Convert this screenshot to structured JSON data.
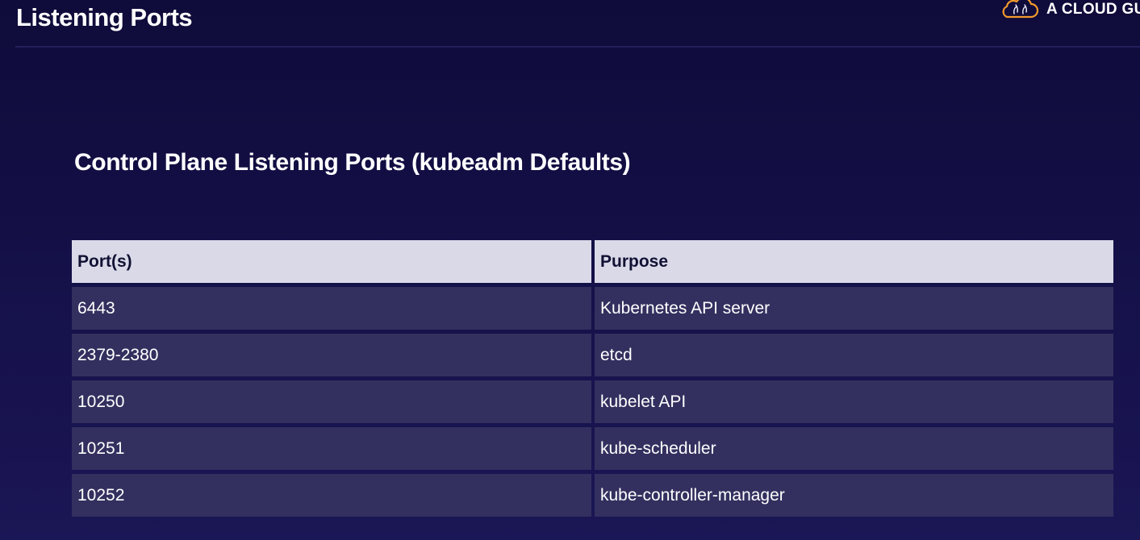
{
  "header": {
    "title": "Listening Ports",
    "brand_text": "A CLOUD GU",
    "brand_logo_icon": "cloud-logo-icon"
  },
  "section": {
    "heading": "Control Plane Listening Ports (kubeadm Defaults)"
  },
  "table": {
    "columns": [
      "Port(s)",
      "Purpose"
    ],
    "rows": [
      [
        "6443",
        "Kubernetes API server"
      ],
      [
        "2379-2380",
        "etcd"
      ],
      [
        "10250",
        "kubelet API"
      ],
      [
        "10251",
        "kube-scheduler"
      ],
      [
        "10252",
        "kube-controller-manager"
      ]
    ]
  },
  "colors": {
    "background": "#141047",
    "header_cell": "#d9d9e8",
    "body_cell": "#33305f",
    "logo_accent": "#f39a2b"
  }
}
